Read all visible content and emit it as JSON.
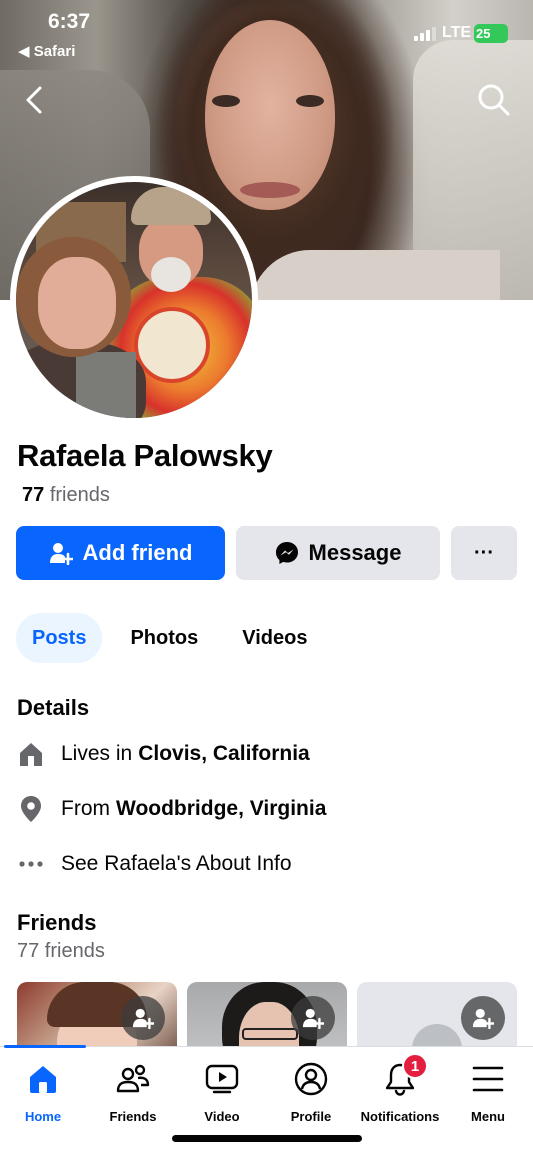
{
  "status_bar": {
    "time": "6:37",
    "back_app": "◀ Safari",
    "network": "LTE",
    "battery": "25"
  },
  "profile": {
    "name": "Rafaela Palowsky",
    "friend_count": "77",
    "friends_word": "friends"
  },
  "actions": {
    "add_friend": "Add friend",
    "message": "Message",
    "more": "···"
  },
  "tabs": [
    {
      "label": "Posts",
      "active": true
    },
    {
      "label": "Photos",
      "active": false
    },
    {
      "label": "Videos",
      "active": false
    }
  ],
  "details": {
    "title": "Details",
    "lives_prefix": "Lives in",
    "lives_place": "Clovis, California",
    "from_prefix": "From",
    "from_place": "Woodbridge, Virginia",
    "about_link": "See Rafaela's About Info"
  },
  "friends": {
    "title": "Friends",
    "subtitle": "77 friends"
  },
  "bottom_nav": [
    {
      "label": "Home",
      "icon": "home-icon",
      "active": true
    },
    {
      "label": "Friends",
      "icon": "friends-icon",
      "active": false
    },
    {
      "label": "Video",
      "icon": "video-icon",
      "active": false
    },
    {
      "label": "Profile",
      "icon": "profile-icon",
      "active": false
    },
    {
      "label": "Notifications",
      "icon": "bell-icon",
      "active": false,
      "badge": "1"
    },
    {
      "label": "Menu",
      "icon": "menu-icon",
      "active": false
    }
  ],
  "colors": {
    "brand_blue": "#0866ff",
    "secondary_button": "#e4e6eb",
    "badge_red": "#e41e3f",
    "muted_text": "#65676b"
  }
}
